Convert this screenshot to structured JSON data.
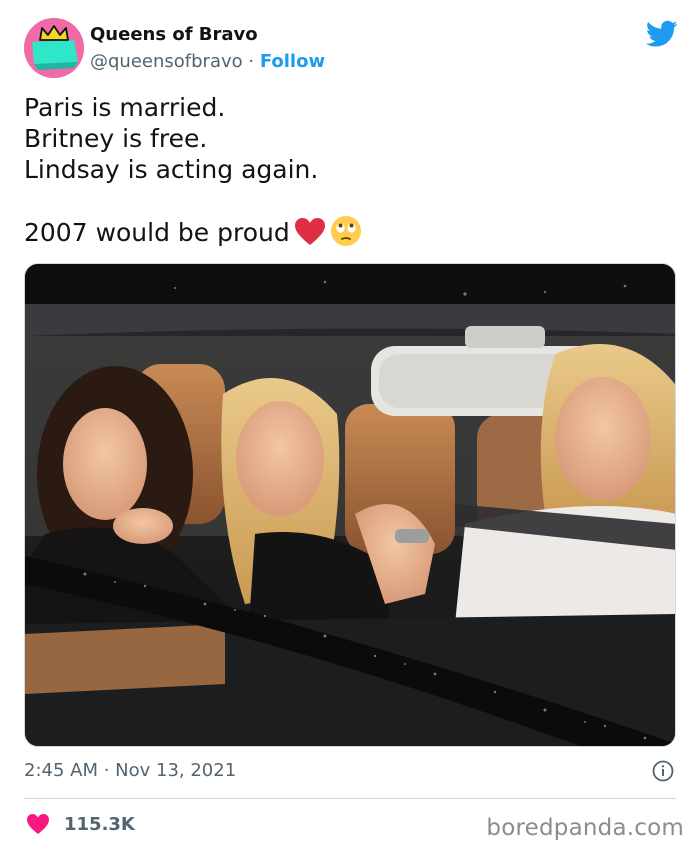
{
  "user": {
    "display_name": "Queens of Bravo",
    "handle": "@queensofbravo",
    "separator": " · ",
    "follow_label": "Follow",
    "avatar_icon": "crown-avatar-icon"
  },
  "tweet": {
    "lines": [
      "Paris is married.",
      "Britney is free.",
      "Lindsay is acting again."
    ],
    "closing": "2007 would be proud",
    "emojis": [
      "red-heart-icon",
      "face-with-rolling-eyes-icon"
    ],
    "photo_description_icon": "car-photo"
  },
  "meta": {
    "timestamp": "2:45 AM · Nov 13, 2021",
    "likes": "115.3K"
  },
  "watermark": "boredpanda.com",
  "colors": {
    "link_blue": "#1d9bf0",
    "like_pink": "#f91880",
    "avatar_pink": "#f06aa8",
    "avatar_teal": "#2ee6c8",
    "crown_yellow": "#f5d623"
  }
}
